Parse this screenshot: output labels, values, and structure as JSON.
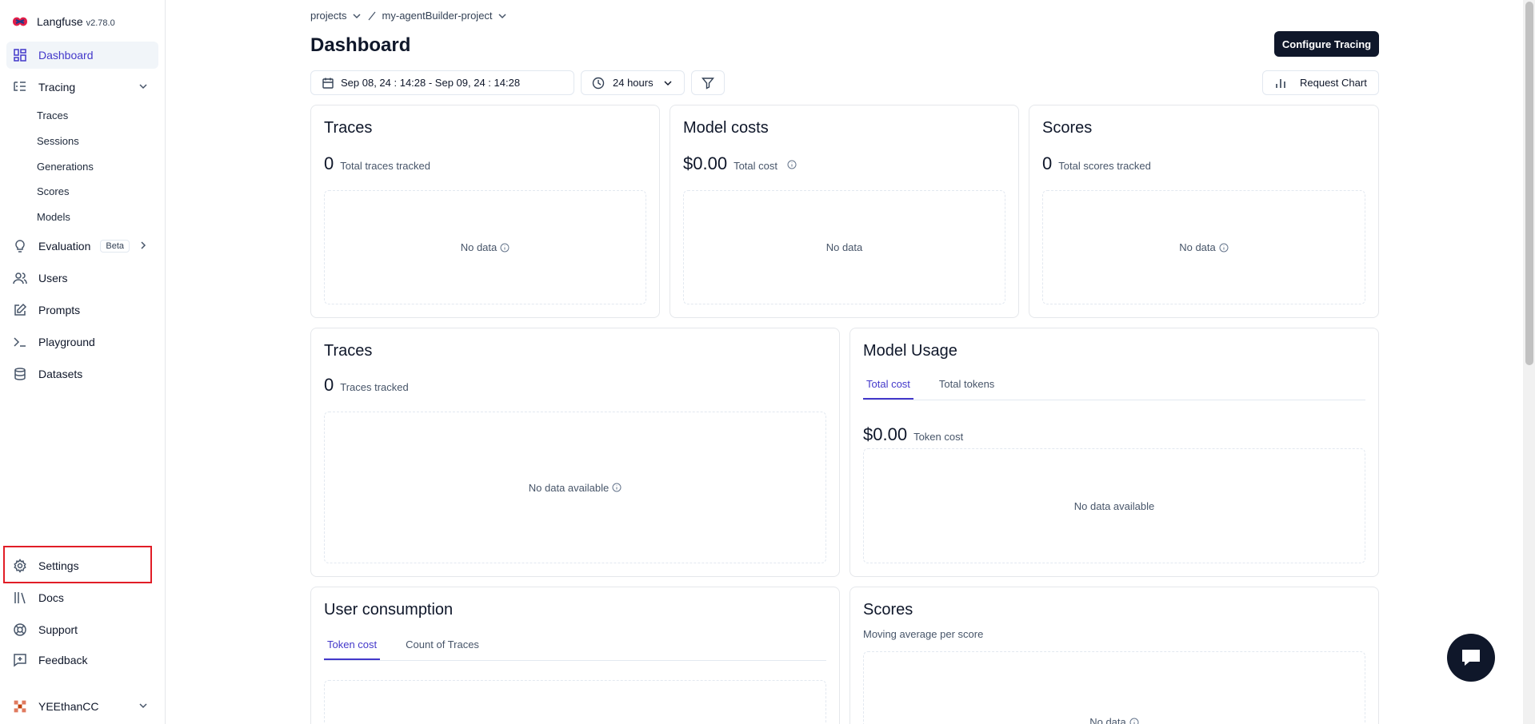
{
  "sidebar": {
    "brand": {
      "name": "Langfuse",
      "version": "v2.78.0"
    },
    "dashboard": "Dashboard",
    "tracing": "Tracing",
    "tracing_sub": [
      "Traces",
      "Sessions",
      "Generations",
      "Scores",
      "Models"
    ],
    "evaluation": "Evaluation",
    "evaluation_badge": "Beta",
    "users": "Users",
    "prompts": "Prompts",
    "playground": "Playground",
    "datasets": "Datasets",
    "settings": "Settings",
    "docs": "Docs",
    "support": "Support",
    "feedback": "Feedback",
    "user": "YEEthanCC"
  },
  "breadcrumb": {
    "projects": "projects",
    "project": "my-agentBuilder-project"
  },
  "header": {
    "title": "Dashboard",
    "configure_button": "Configure Tracing"
  },
  "controls": {
    "date_range": "Sep 08, 24 : 14:28 - Sep 09, 24 : 14:28",
    "time_window": "24 hours",
    "request_chart": "Request Chart"
  },
  "cards": {
    "traces_top": {
      "title": "Traces",
      "value": "0",
      "label": "Total traces tracked",
      "empty": "No data"
    },
    "model_costs": {
      "title": "Model costs",
      "value": "$0.00",
      "label": "Total cost",
      "empty": "No data"
    },
    "scores_top": {
      "title": "Scores",
      "value": "0",
      "label": "Total scores tracked",
      "empty": "No data"
    },
    "traces_mid": {
      "title": "Traces",
      "value": "0",
      "label": "Traces tracked",
      "empty": "No data available"
    },
    "model_usage": {
      "title": "Model Usage",
      "tabs": [
        "Total cost",
        "Total tokens"
      ],
      "value": "$0.00",
      "label": "Token cost",
      "empty": "No data available"
    },
    "user_consumption": {
      "title": "User consumption",
      "tabs": [
        "Token cost",
        "Count of Traces"
      ]
    },
    "scores_bottom": {
      "title": "Scores",
      "subtitle": "Moving average per score",
      "empty": "No data"
    }
  },
  "colors": {
    "accent": "#4338ca",
    "primary": "#0f172a",
    "highlight": "#e11d26"
  }
}
